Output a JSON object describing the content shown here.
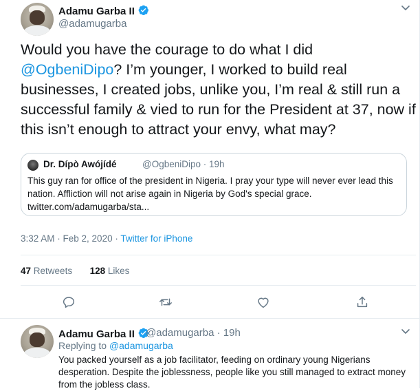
{
  "main_tweet": {
    "author_name": "Adamu Garba II",
    "author_handle": "@adamugarba",
    "text_before_mention": "Would you have the courage to do what I did ",
    "mention": "@OgbeniDipo",
    "text_after_mention": "? I’m younger, I worked to build real businesses, I created jobs, unlike you, I’m real & still run a successful family & vied to run for the President at 37,  now if this isn’t enough to attract your envy, what may?",
    "quoted": {
      "author_name": "Dr. Dípò Awójídé",
      "author_handle_time": "@OgbeniDipo · 19h",
      "text": "This guy ran for office of the president in Nigeria. I pray your type will never ever lead this nation. Affliction will not arise again in Nigeria by God's special grace. twitter.com/adamugarba/sta..."
    },
    "timestamp": "3:32 AM · Feb 2, 2020 · ",
    "source": "Twitter for iPhone",
    "retweets_count": "47",
    "retweets_label": "Retweets",
    "likes_count": "128",
    "likes_label": "Likes",
    "actions": [
      "reply-icon",
      "retweet-icon",
      "like-icon",
      "share-icon"
    ]
  },
  "reply_tweet": {
    "author_name": "Adamu Garba II",
    "author_handle_time": "@adamugarba · 19h",
    "replying_prefix": "Replying to ",
    "replying_to": "@adamugarba",
    "text": "You packed yourself as a job facilitator, feeding on ordinary young Nigerians desperation. Despite the joblessness, people like you still managed to extract money from the jobless class."
  },
  "colors": {
    "accent": "#1b95e0",
    "verified": "#1da1f2",
    "secondary_text": "#657786",
    "border": "#e6ecf0"
  }
}
